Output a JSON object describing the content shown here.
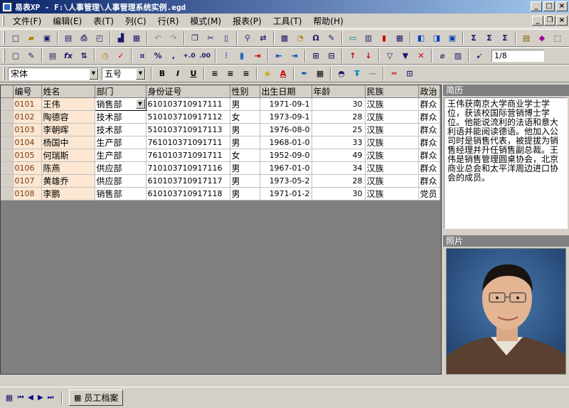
{
  "window": {
    "title": "易表XP - F:\\人事管理\\人事管理系统实例.egd"
  },
  "menu": [
    "文件(F)",
    "编辑(E)",
    "表(T)",
    "列(C)",
    "行(R)",
    "模式(M)",
    "报表(P)",
    "工具(T)",
    "帮助(H)"
  ],
  "toolbar": {
    "page_indicator": "1/8",
    "font_name": "宋体",
    "font_size": "五号"
  },
  "grid": {
    "columns": [
      "编号",
      "姓名",
      "部门",
      "身份证号",
      "性别",
      "出生日期",
      "年龄",
      "民族",
      "政治"
    ],
    "rows": [
      {
        "code": "0101",
        "name": "王伟",
        "dept": "销售部",
        "id": "610103710917111",
        "sex": "男",
        "birth": "1971-09-1",
        "age": "30",
        "nation": "汉族",
        "politics": "群众"
      },
      {
        "code": "0102",
        "name": "陶德容",
        "dept": "技术部",
        "id": "510103710917112",
        "sex": "女",
        "birth": "1973-09-1",
        "age": "28",
        "nation": "汉族",
        "politics": "群众"
      },
      {
        "code": "0103",
        "name": "李朝晖",
        "dept": "技术部",
        "id": "510103710917113",
        "sex": "男",
        "birth": "1976-08-0",
        "age": "25",
        "nation": "汉族",
        "politics": "群众"
      },
      {
        "code": "0104",
        "name": "杨国中",
        "dept": "生产部",
        "id": "761010371091711",
        "sex": "男",
        "birth": "1968-01-0",
        "age": "33",
        "nation": "汉族",
        "politics": "群众"
      },
      {
        "code": "0105",
        "name": "何瑞斯",
        "dept": "生产部",
        "id": "761010371091711",
        "sex": "女",
        "birth": "1952-09-0",
        "age": "49",
        "nation": "汉族",
        "politics": "群众"
      },
      {
        "code": "0106",
        "name": "陈燕",
        "dept": "供应部",
        "id": "710103710917116",
        "sex": "男",
        "birth": "1967-01-0",
        "age": "34",
        "nation": "汉族",
        "politics": "群众"
      },
      {
        "code": "0107",
        "name": "黄雄乔",
        "dept": "供应部",
        "id": "610103710917117",
        "sex": "男",
        "birth": "1973-05-2",
        "age": "28",
        "nation": "汉族",
        "politics": "群众"
      },
      {
        "code": "0108",
        "name": "李鹏",
        "dept": "销售部",
        "id": "610103710917118",
        "sex": "男",
        "birth": "1971-01-2",
        "age": "30",
        "nation": "汉族",
        "politics": "党员"
      }
    ]
  },
  "resume": {
    "label": "简历",
    "text": "王伟获南京大学商业学士学位，获该校国际营销博士学位。他能说流利的法语和意大利语并能阅读德语。他加入公司时是销售代表，被提拔为销售经理并升任销售副总裁。王伟是销售管理圆桌协会，北京商业总会和太平洋周边进口协会的成员。"
  },
  "photo": {
    "label": "照片"
  },
  "status": {
    "sheet_tab": "员工档案"
  }
}
